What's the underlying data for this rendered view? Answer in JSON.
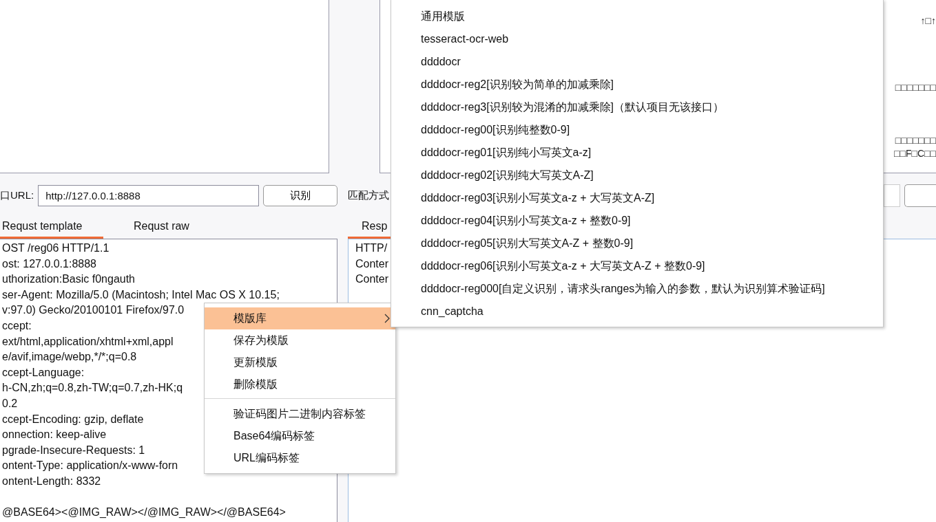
{
  "garbled_panel": {
    "lines": [
      {
        "kind": "blank"
      },
      {
        "kind": "text",
        "text": "↑□↑"
      },
      {
        "kind": "blank"
      },
      {
        "kind": "blank"
      },
      {
        "kind": "blank"
      },
      {
        "kind": "blank"
      },
      {
        "kind": "text",
        "text": "□□□□□□□"
      },
      {
        "kind": "blank"
      },
      {
        "kind": "blank"
      },
      {
        "kind": "blank"
      },
      {
        "kind": "text",
        "text": "□□□□□□□"
      },
      {
        "kind": "text",
        "text": "□□F□C□□"
      }
    ]
  },
  "url_bar": {
    "label": "口URL:",
    "value": "http://127.0.0.1:8888",
    "button": "识别"
  },
  "match_bar": {
    "label": "匹配方式"
  },
  "request_tabs": [
    {
      "label": "Requst template",
      "selected": true
    },
    {
      "label": "Requst raw",
      "selected": false
    }
  ],
  "response_tabs": [
    {
      "label": "Resp",
      "selected": true
    }
  ],
  "request_lines": [
    {
      "text": "OST /reg06 HTTP/1.1"
    },
    {
      "text": "ost: 127.0.0.1:8888"
    },
    {
      "text": "uthorization:Basic f0ngauth"
    },
    {
      "text": "ser-Agent: Mozilla/5.0 (Macintosh; Intel Mac OS X 10.15;"
    },
    {
      "text": "v:97.0) Gecko/20100101 Firefox/97.0"
    },
    {
      "text": "ccept:"
    },
    {
      "text": "ext/html,application/xhtml+xml,appl"
    },
    {
      "text": "e/avif,image/webp,*/*;q=0.8"
    },
    {
      "text": "ccept-Language:"
    },
    {
      "text": "h-CN,zh;q=0.8,zh-TW;q=0.7,zh-HK;q"
    },
    {
      "text": "0.2"
    },
    {
      "text": "ccept-Encoding: gzip, deflate"
    },
    {
      "text": "onnection: keep-alive"
    },
    {
      "text": "pgrade-Insecure-Requests: 1"
    },
    {
      "text": "ontent-Type: application/x-www-forn"
    },
    {
      "text": "ontent-Length: 8332"
    },
    {
      "kind": "blank"
    },
    {
      "kind": "text",
      "text": "@BASE64><@IMG_RAW></@IMG_RAW></@BASE64>"
    }
  ],
  "response_lines": [
    "HTTP/",
    "Conter",
    "Conter"
  ],
  "context_menu": {
    "groups": [
      [
        {
          "label": "模版库",
          "selected": true,
          "submenu": true
        },
        {
          "label": "保存为模版",
          "selected": false,
          "submenu": false
        },
        {
          "label": "更新模版",
          "selected": false,
          "submenu": false
        },
        {
          "label": "删除模版",
          "selected": false,
          "submenu": false
        }
      ],
      [
        {
          "label": "验证码图片二进制内容标签",
          "selected": false,
          "submenu": false
        },
        {
          "label": "Base64编码标签",
          "selected": false,
          "submenu": false
        },
        {
          "label": "URL编码标签",
          "selected": false,
          "submenu": false
        }
      ]
    ]
  },
  "submenu": {
    "items": [
      "通用模版",
      "tesseract-ocr-web",
      "ddddocr",
      "ddddocr-reg2[识别较为简单的加减乘除]",
      "ddddocr-reg3[识别较为混淆的加减乘除]（默认项目无该接口）",
      "ddddocr-reg00[识别纯整数0-9]",
      "ddddocr-reg01[识别纯小写英文a-z]",
      "ddddocr-reg02[识别纯大写英文A-Z]",
      "ddddocr-reg03[识别小写英文a-z + 大写英文A-Z]",
      "ddddocr-reg04[识别小写英文a-z + 整数0-9]",
      "ddddocr-reg05[识别大写英文A-Z + 整数0-9]",
      "ddddocr-reg06[识别小写英文a-z + 大写英文A-Z + 整数0-9]",
      "ddddocr-reg000[自定义识别，请求头ranges为输入的参数，默认为识别算术验证码]",
      "cnn_captcha"
    ]
  }
}
